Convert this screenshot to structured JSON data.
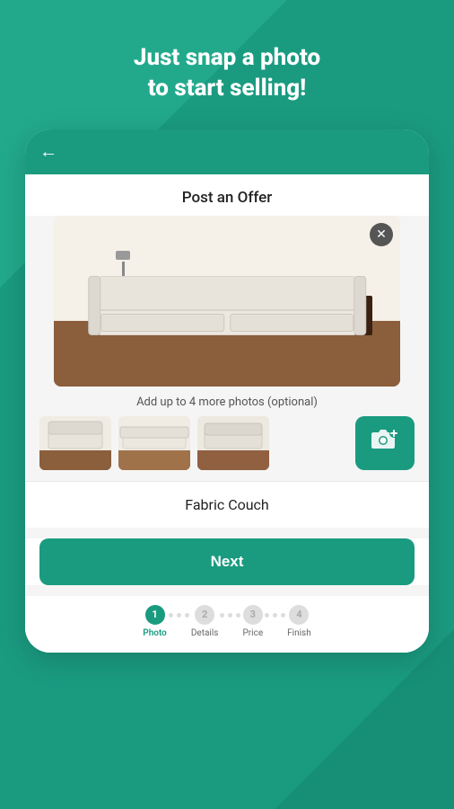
{
  "background": {
    "color": "#1a9b80"
  },
  "header": {
    "line1": "Just snap a photo",
    "line2": "to start selling!"
  },
  "topbar": {
    "back_label": "←"
  },
  "content": {
    "title": "Post an Offer",
    "add_photos_text": "Add up to 4 more photos (optional)",
    "item_name": "Fabric Couch",
    "next_button": "Next",
    "close_icon": "✕"
  },
  "thumbnails": [
    {
      "id": 1,
      "class": "mini-couch-1"
    },
    {
      "id": 2,
      "class": "mini-couch-2"
    },
    {
      "id": 3,
      "class": "mini-couch-3"
    }
  ],
  "steps": [
    {
      "label": "Photo",
      "number": "1",
      "active": true
    },
    {
      "label": "Details",
      "number": "2",
      "active": false
    },
    {
      "label": "Price",
      "number": "3",
      "active": false
    },
    {
      "label": "Finish",
      "number": "4",
      "active": false
    }
  ]
}
